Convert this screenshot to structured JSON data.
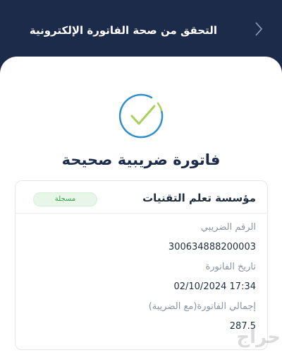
{
  "header": {
    "title": "التحقق من صحة الفاتورة الإلكترونية",
    "back_icon": "chevron-right-icon"
  },
  "result": {
    "icon": "check-circle-icon",
    "title": "فاتورة ضريبية صحيحة",
    "accent_color": "#9ccc3c",
    "ring_color": "#3a9ad6"
  },
  "card": {
    "company_name": "مؤسسة تعلم التقنيات",
    "status_badge": "مسجلة",
    "fields": [
      {
        "label": "الرقم الضريبي",
        "value": "300634888200003"
      },
      {
        "label": "تاريخ الفاتورة",
        "value": "02/10/2024 17:34"
      },
      {
        "label": "إجمالي الفاتورة(مع الضريبة)",
        "value": "287.5"
      }
    ]
  },
  "watermark": {
    "text": "حراج"
  }
}
